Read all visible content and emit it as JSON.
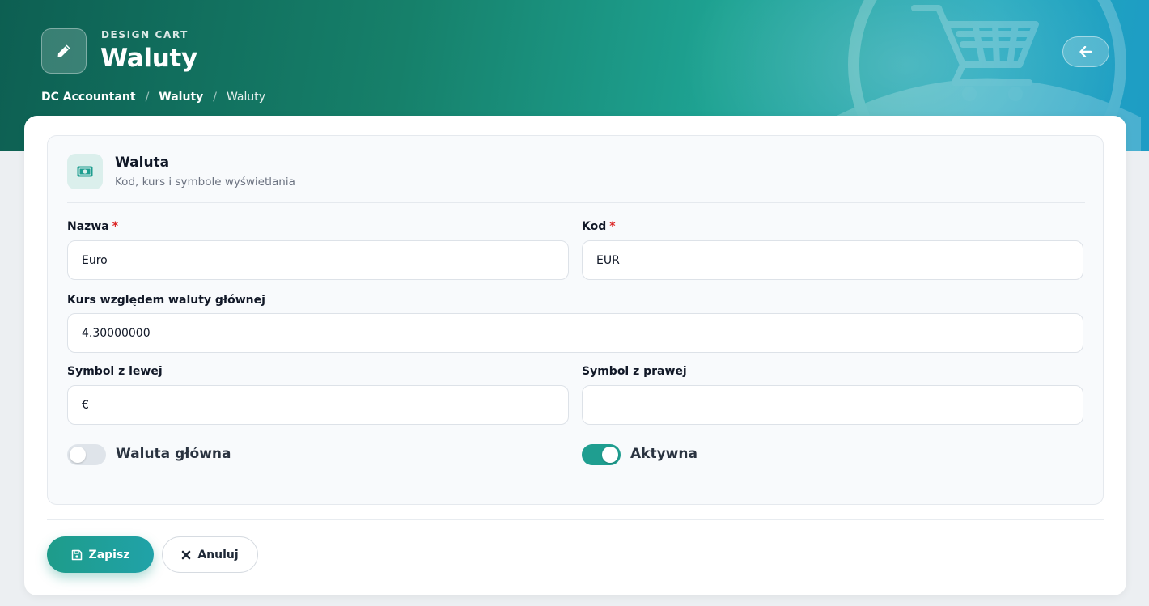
{
  "header": {
    "eyebrow": "DESIGN CART",
    "title": "Waluty",
    "breadcrumb": [
      "DC Accountant",
      "Waluty",
      "Waluty"
    ],
    "back_icon": "arrow-left-icon",
    "title_icon": "pencil-icon"
  },
  "section": {
    "icon": "money-bill-icon",
    "title": "Waluta",
    "subtitle": "Kod, kurs i symbole wyświetlania"
  },
  "form": {
    "name": {
      "label": "Nazwa",
      "required_mark": "*",
      "value": "Euro"
    },
    "code": {
      "label": "Kod",
      "required_mark": "*",
      "value": "EUR"
    },
    "rate": {
      "label": "Kurs względem waluty głównej",
      "value": "4.30000000"
    },
    "symbol_left": {
      "label": "Symbol z lewej",
      "value": "€"
    },
    "symbol_right": {
      "label": "Symbol z prawej",
      "value": ""
    },
    "main_currency": {
      "label": "Waluta główna",
      "checked": false
    },
    "active": {
      "label": "Aktywna",
      "checked": true
    }
  },
  "actions": {
    "save_label": "Zapisz",
    "save_icon": "floppy-disk-icon",
    "cancel_label": "Anuluj",
    "cancel_icon": "close-icon"
  },
  "colors": {
    "accent": "#1f9e90",
    "required": "#dc2626"
  }
}
